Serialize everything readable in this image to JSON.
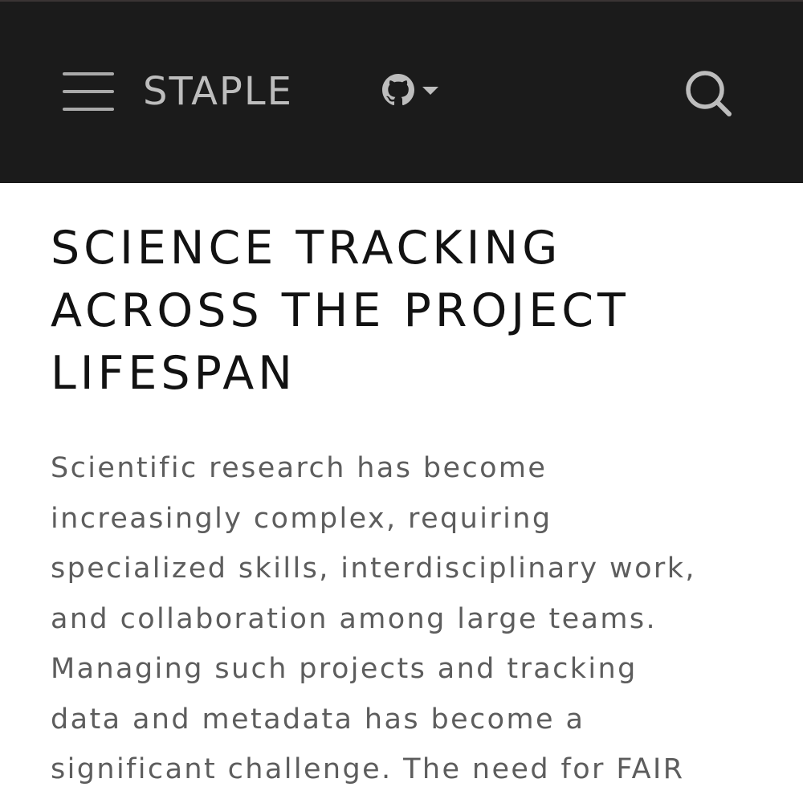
{
  "navbar": {
    "menu_icon": "hamburger-menu-icon",
    "brand": "STAPLE",
    "github_icon": "github-icon",
    "caret_icon": "caret-down-icon",
    "search_icon": "search-icon",
    "background": "#1b1b1b",
    "foreground": "#bdbdbd"
  },
  "main": {
    "heading_lines": [
      "SCIENCE TRACKING",
      "ACROSS THE PROJECT",
      "LIFESPAN"
    ],
    "paragraph_lines": [
      "Scientific research has become",
      "increasingly complex, requiring",
      "specialized skills, interdisciplinary work,",
      "and collaboration among large teams.",
      "Managing such projects and tracking",
      "data and metadata has become a",
      "significant challenge. The need for FAIR"
    ],
    "heading_color": "#121212",
    "text_color": "#5d5d5d"
  }
}
